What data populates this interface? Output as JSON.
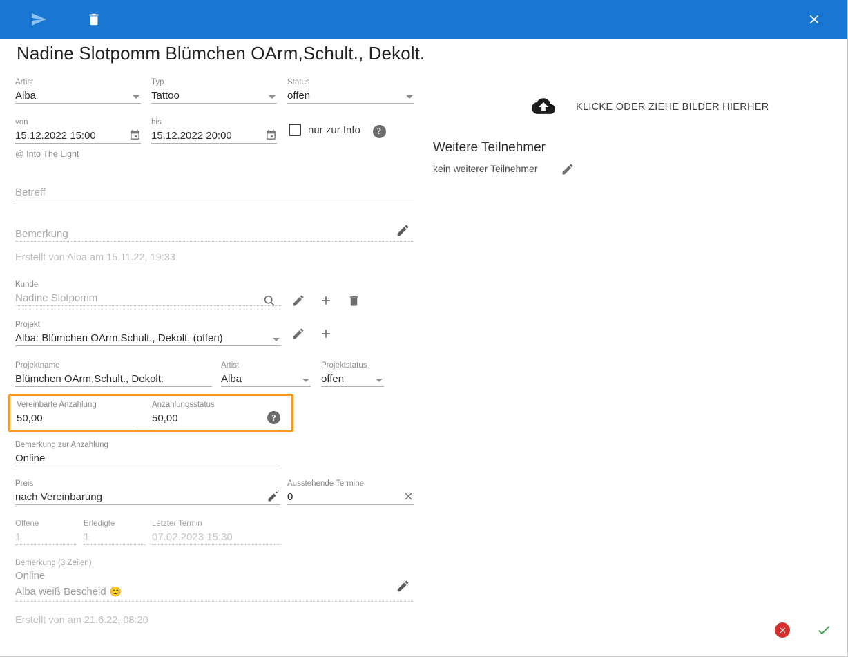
{
  "toolbar": {
    "send_icon": "send-icon",
    "delete_icon": "trash-icon",
    "close_icon": "close-icon"
  },
  "page_title": "Nadine Slotpomm Blümchen OArm,Schult., Dekolt.",
  "appointment": {
    "artist": {
      "label": "Artist",
      "value": "Alba"
    },
    "typ": {
      "label": "Typ",
      "value": "Tattoo"
    },
    "status": {
      "label": "Status",
      "value": "offen"
    },
    "von": {
      "label": "von",
      "value": "15.12.2022 15:00"
    },
    "bis": {
      "label": "bis",
      "value": "15.12.2022 20:00"
    },
    "info_only": {
      "label": "nur zur Info",
      "checked": false
    },
    "location": "@ Into The Light",
    "betreff": {
      "label": "",
      "placeholder": "Betreff",
      "value": ""
    },
    "bemerkung": {
      "label": "",
      "placeholder": "Bemerkung",
      "value": ""
    },
    "created": "Erstellt von Alba am 15.11.22, 19:33"
  },
  "kunde": {
    "label": "Kunde",
    "value": "Nadine Slotpomm",
    "icons": [
      "search-icon",
      "pencil-icon",
      "plus-icon",
      "trash-icon"
    ]
  },
  "projekt": {
    "label": "Projekt",
    "value": "Alba: Blümchen OArm,Schult., Dekolt. (offen)",
    "icons": [
      "pencil-icon",
      "plus-icon"
    ]
  },
  "projekt_details": {
    "projektname": {
      "label": "Projektname",
      "value": "Blümchen OArm,Schult., Dekolt."
    },
    "artist": {
      "label": "Artist",
      "value": "Alba"
    },
    "projektstatus": {
      "label": "Projektstatus",
      "value": "offen"
    },
    "vereinbarte_anzahlung": {
      "label": "Vereinbarte Anzahlung",
      "value": "50,00"
    },
    "anzahlungsstatus": {
      "label": "Anzahlungsstatus",
      "value": "50,00"
    },
    "bemerkung_anzahlung": {
      "label": "Bemerkung zur Anzahlung",
      "value": "Online"
    },
    "preis": {
      "label": "Preis",
      "value": "nach Vereinbarung"
    },
    "ausstehende_termine": {
      "label": "Ausstehende Termine",
      "value": "0"
    },
    "offene": {
      "label": "Offene",
      "value": "1"
    },
    "erledigte": {
      "label": "Erledigte",
      "value": "1"
    },
    "letzter_termin": {
      "label": "Letzter Termin",
      "value": "07.02.2023 15:30"
    },
    "bemerkung_3": {
      "label": "Bemerkung (3 Zeilen)",
      "line1": "Online",
      "line2": "Alba weiß Bescheid",
      "emoji": "😊"
    },
    "created": "Erstellt von am 21.6.22, 08:20"
  },
  "right_panel": {
    "upload_text": "KLICKE ODER ZIEHE BILDER HIERHER",
    "upload_icon": "cloud-upload-icon",
    "participants_heading": "Weitere Teilnehmer",
    "participants_value": "kein weiterer Teilnehmer",
    "participants_edit_icon": "pencil-icon"
  },
  "footer": {
    "cancel_icon": "cancel-circle-icon",
    "confirm_icon": "check-icon"
  },
  "colors": {
    "toolbar_blue": "#1976d2",
    "highlight_orange": "#f59a1e",
    "cancel_red": "#d32f2f",
    "confirm_green": "#2e7d32"
  }
}
